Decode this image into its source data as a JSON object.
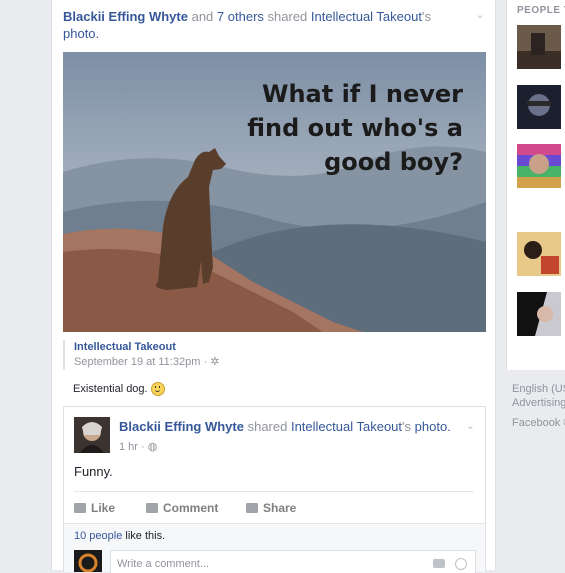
{
  "story": {
    "actor": "Blackii Effing Whyte",
    "and_text": "and",
    "others": "7 others",
    "shared_text": "shared",
    "page": "Intellectual Takeout",
    "photo_suffix": "'s",
    "photo": "photo."
  },
  "photo_caption": {
    "line1": "What if I never",
    "line2": "find out who's a",
    "line3": "good boy?"
  },
  "source": {
    "name": "Intellectual Takeout",
    "date": "September 19 at 11:32pm",
    "sep": "·",
    "description": "Existential dog."
  },
  "share_post": {
    "author": "Blackii Effing Whyte",
    "shared_text": "shared",
    "page": "Intellectual Takeout",
    "suffix": "'s",
    "photo": "photo.",
    "time": "1 hr",
    "sep": "·",
    "text": "Funny."
  },
  "actions": {
    "like": "Like",
    "comment": "Comment",
    "share": "Share"
  },
  "likes": {
    "count": "10 people",
    "suffix": "like this."
  },
  "comment": {
    "placeholder": "Write a comment..."
  },
  "right_column": {
    "label": "PEOPLE Y"
  },
  "footer": {
    "lang": "English (US",
    "advertising": "Advertising",
    "facebook": "Facebook ©"
  },
  "icons": {
    "chevron": "chevron-down-icon",
    "globe": "globe-icon",
    "like": "thumbs-up-icon",
    "comment": "comment-icon",
    "share": "share-arrow-icon",
    "camera": "camera-icon",
    "emoji": "emoji-icon"
  }
}
